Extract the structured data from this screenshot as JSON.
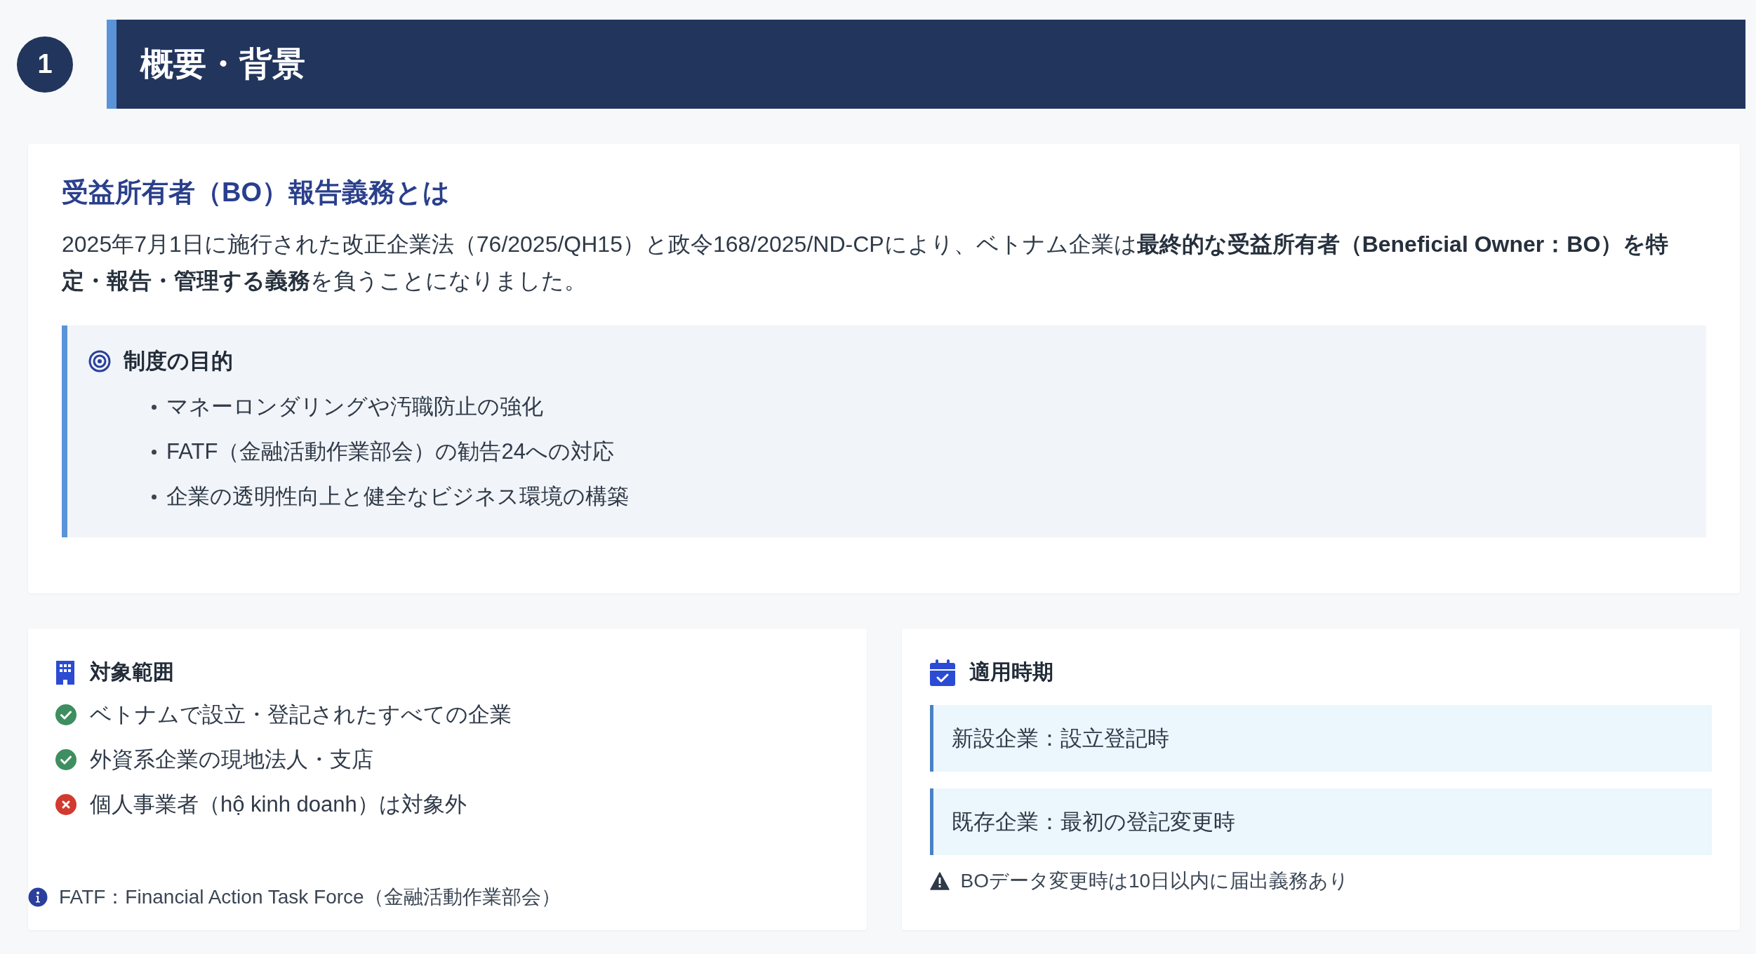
{
  "section": {
    "number": "1",
    "title": "概要・背景"
  },
  "overview": {
    "title": "受益所有者（BO）報告義務とは",
    "text": "2025年7月1日に施行された改正企業法（76/2025/QH15）と政令168/2025/ND-CPにより、ベトナム企業は**最終的な受益所有者（Beneficial Owner：BO）を特定・報告・管理する義務**を負うことになりました。",
    "purpose": {
      "title": "制度の目的",
      "items": [
        "マネーロンダリングや汚職防止の強化",
        "FATF（金融活動作業部会）の勧告24への対応",
        "企業の透明性向上と健全なビジネス環境の構築"
      ]
    }
  },
  "scope": {
    "title": "対象範囲",
    "items": [
      {
        "text": "ベトナムで設立・登記されたすべての企業",
        "included": true
      },
      {
        "text": "外資系企業の現地法人・支店",
        "included": true
      },
      {
        "text": "個人事業者（hộ kinh doanh）は対象外",
        "included": false
      }
    ],
    "footnote": "FATF：Financial Action Task Force（金融活動作業部会）"
  },
  "timing": {
    "title": "適用時期",
    "items": [
      "新設企業：設立登記時",
      "既存企業：最初の登記変更時"
    ],
    "warning": "BOデータ変更時は10日以内に届出義務あり"
  }
}
